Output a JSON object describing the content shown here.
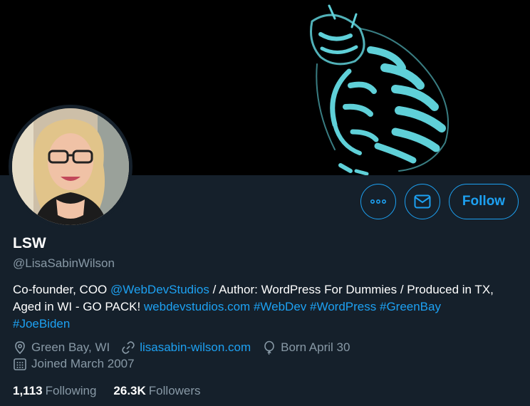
{
  "profile": {
    "name": "LSW",
    "handle": "@LisaSabinWilson",
    "bio": {
      "t1": "Co-founder, COO ",
      "mention": "@WebDevStudios",
      "t2": " / Author: WordPress For Dummies / Produced in TX, Aged in WI - GO PACK! ",
      "url": "webdevstudios.com",
      "tags": [
        "#WebDev",
        "#WordPress",
        "#GreenBay",
        "#JoeBiden"
      ]
    },
    "location": "Green Bay, WI",
    "website": "lisasabin-wilson.com",
    "birthday": "Born April 30",
    "joined": "Joined March 2007"
  },
  "actions": {
    "follow_label": "Follow",
    "more_icon": "ellipsis-icon",
    "message_icon": "envelope-icon"
  },
  "stats": {
    "following_count": "1,113",
    "following_label": "Following",
    "followers_count": "26.3K",
    "followers_label": "Followers"
  },
  "colors": {
    "background": "#15202b",
    "accent": "#1da1f2",
    "secondary_text": "#8899a6",
    "banner_cat": "#5fd0d8"
  }
}
